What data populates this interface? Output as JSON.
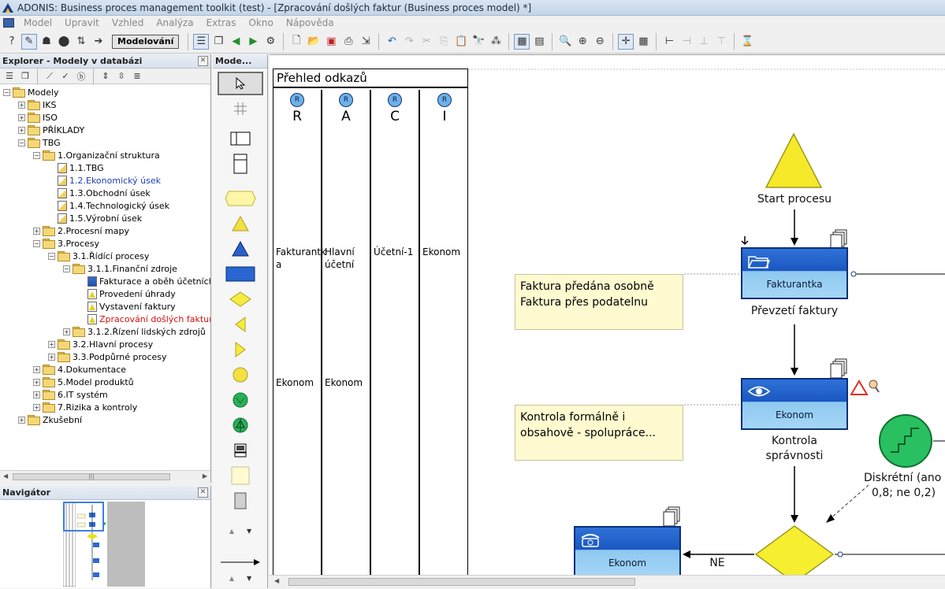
{
  "window": {
    "title": "ADONIS: Business proces management toolkit (test) - [Zpracování došlých faktur (Business proces model) *]"
  },
  "menu": [
    "Model",
    "Upravit",
    "Vzhled",
    "Analýza",
    "Extras",
    "Okno",
    "Nápověda"
  ],
  "toolbar": {
    "mode_label": "Modelování"
  },
  "explorer": {
    "title": "Explorer - Modely v databázi",
    "tree": [
      {
        "label": "Modely",
        "level": 0,
        "icon": "folder",
        "expander": "minus"
      },
      {
        "label": "IKS",
        "level": 1,
        "icon": "folder",
        "expander": "plus"
      },
      {
        "label": "ISO",
        "level": 1,
        "icon": "folder",
        "expander": "plus"
      },
      {
        "label": "PŘÍKLADY",
        "level": 1,
        "icon": "folder",
        "expander": "plus"
      },
      {
        "label": "TBG",
        "level": 1,
        "icon": "folder",
        "expander": "minus"
      },
      {
        "label": "1.Organizační struktura",
        "level": 2,
        "icon": "folder",
        "expander": "minus"
      },
      {
        "label": "1.1.TBG",
        "level": 3,
        "icon": "model",
        "expander": ""
      },
      {
        "label": "1.2.Ekonomický úsek",
        "level": 3,
        "icon": "model",
        "expander": "",
        "style": "blue"
      },
      {
        "label": "1.3.Obchodní úsek",
        "level": 3,
        "icon": "model",
        "expander": ""
      },
      {
        "label": "1.4.Technologický úsek",
        "level": 3,
        "icon": "model",
        "expander": ""
      },
      {
        "label": "1.5.Výrobní úsek",
        "level": 3,
        "icon": "model",
        "expander": ""
      },
      {
        "label": "2.Procesní mapy",
        "level": 2,
        "icon": "folder",
        "expander": "plus"
      },
      {
        "label": "3.Procesy",
        "level": 2,
        "icon": "folder",
        "expander": "minus"
      },
      {
        "label": "3.1.Řídící procesy",
        "level": 3,
        "icon": "folder",
        "expander": "minus"
      },
      {
        "label": "3.1.1.Finanční zdroje",
        "level": 4,
        "icon": "folder",
        "expander": "minus"
      },
      {
        "label": "Fakturace a oběh účetních",
        "level": 5,
        "icon": "model-blue",
        "expander": ""
      },
      {
        "label": "Provedení úhrady",
        "level": 5,
        "icon": "model-tri",
        "expander": ""
      },
      {
        "label": "Vystavení faktury",
        "level": 5,
        "icon": "model-tri",
        "expander": ""
      },
      {
        "label": "Zpracování došlých faktur",
        "level": 5,
        "icon": "model-tri",
        "expander": "",
        "style": "red"
      },
      {
        "label": "3.1.2.Řízení lidských zdrojů",
        "level": 4,
        "icon": "folder",
        "expander": "plus"
      },
      {
        "label": "3.2.Hlavní procesy",
        "level": 3,
        "icon": "folder",
        "expander": "plus"
      },
      {
        "label": "3.3.Podpůrné procesy",
        "level": 3,
        "icon": "folder",
        "expander": "plus"
      },
      {
        "label": "4.Dokumentace",
        "level": 2,
        "icon": "folder",
        "expander": "plus"
      },
      {
        "label": "5.Model produktů",
        "level": 2,
        "icon": "folder",
        "expander": "plus"
      },
      {
        "label": "6.IT systém",
        "level": 2,
        "icon": "folder",
        "expander": "plus"
      },
      {
        "label": "7.Rizika a kontroly",
        "level": 2,
        "icon": "folder",
        "expander": "plus"
      },
      {
        "label": "Zkušební",
        "level": 1,
        "icon": "folder",
        "expander": "plus"
      }
    ]
  },
  "navigator": {
    "title": "Navigátor"
  },
  "palette": {
    "title": "Mode..."
  },
  "canvas": {
    "raci": {
      "title": "Přehled odkazů",
      "columns": [
        {
          "letter": "R",
          "badge": "R",
          "row1": "Fakturantka",
          "row2": "Ekonom"
        },
        {
          "letter": "A",
          "badge": "R",
          "row1": "Hlavní účetní",
          "row2": "Ekonom"
        },
        {
          "letter": "C",
          "badge": "R",
          "row1": "Účetní-1",
          "row2": ""
        },
        {
          "letter": "I",
          "badge": "R",
          "row1": "Ekonom",
          "row2": ""
        }
      ],
      "row1_split": [
        "Fakturantk",
        "a"
      ],
      "row1_split_b": [
        "Hlavní",
        "účetní"
      ]
    },
    "start_label": "Start procesu",
    "activities": [
      {
        "role": "Fakturantka",
        "caption": "Převzetí faktury",
        "icon": "folder-icon"
      },
      {
        "role": "Ekonom",
        "caption1": "Kontrola",
        "caption2": "správnosti",
        "icon": "eye-icon"
      },
      {
        "role": "Ekonom",
        "caption": "",
        "icon": "phone-icon"
      }
    ],
    "notes": [
      {
        "line1": "Faktura předána osobně",
        "line2": "Faktura přes podatelnu"
      },
      {
        "line1": "Kontrola formálně i",
        "line2": "obsahově - spolupráce..."
      }
    ],
    "decision": {
      "line1": "Diskrétní (ano",
      "line2": "0,8; ne 0,2)"
    },
    "edge_label": "NE"
  }
}
